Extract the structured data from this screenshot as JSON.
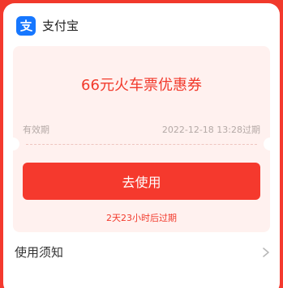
{
  "header": {
    "app_name": "支付宝",
    "logo_icon": "alipay-logo-icon",
    "logo_color": "#1677ff"
  },
  "coupon": {
    "title": "66元火车票优惠券",
    "validity_label": "有效期",
    "validity_value": "2022-12-18 13:28过期",
    "use_button_label": "去使用",
    "expire_countdown": "2天23小时后过期"
  },
  "rules": {
    "label": "使用须知",
    "chevron_icon": "chevron-right-icon"
  },
  "colors": {
    "accent": "#f5392d",
    "coupon_bg": "#fff1ef",
    "muted_text": "#b4a9a6"
  }
}
